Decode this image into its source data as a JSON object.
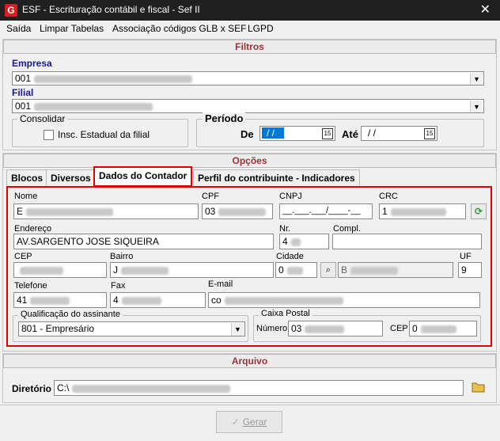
{
  "window": {
    "title": "ESF - Escrituração contábil e fiscal - Sef II",
    "logo_letter": "G",
    "close_glyph": "✕"
  },
  "menu": [
    "Saída",
    "Limpar Tabelas",
    "Associação códigos GLB x SEF",
    "LGPD"
  ],
  "filtros": {
    "header": "Filtros",
    "empresa_label": "Empresa",
    "empresa_value": "001",
    "filial_label": "Filial",
    "filial_value": "001",
    "consolidar_title": "Consolidar",
    "insc_label": "Insc. Estadual da filial",
    "periodo_title": "Período",
    "de_label": "De",
    "de_value": "/ /",
    "ate_label": "Até",
    "ate_value": "/ /",
    "cal_icon": "15"
  },
  "opcoes": {
    "header": "Opções",
    "tabs": [
      "Blocos",
      "Diversos",
      "Dados do Contador",
      "Perfil do contribuinte - Indicadores"
    ],
    "active_tab": 2
  },
  "contador": {
    "nome_label": "Nome",
    "nome_value": "E",
    "cpf_label": "CPF",
    "cpf_value": "03",
    "cnpj_label": "CNPJ",
    "cnpj_value": "__.___.___/____-__",
    "crc_label": "CRC",
    "crc_value": "1",
    "endereco_label": "Endereço",
    "endereco_value": "AV.SARGENTO JOSE SIQUEIRA",
    "nr_label": "Nr.",
    "nr_value": "4",
    "compl_label": "Compl.",
    "compl_value": "",
    "cep_label": "CEP",
    "cep_value": "",
    "bairro_label": "Bairro",
    "bairro_value": "J",
    "cidade_label": "Cidade",
    "cidade_value": "0",
    "cidade_name": "B",
    "uf_label": "UF",
    "uf_value": "9",
    "telefone_label": "Telefone",
    "telefone_value": "41",
    "fax_label": "Fax",
    "fax_value": "4",
    "email_label": "E-mail",
    "email_value": "co",
    "qualificacao_title": "Qualificação do assinante",
    "qualificacao_value": "801 - Empresário",
    "caixa_title": "Caixa Postal",
    "numero_label": "Número",
    "numero_value": "03",
    "cep2_label": "CEP",
    "cep2_value": "0"
  },
  "arquivo": {
    "header": "Arquivo",
    "diretorio_label": "Diretório",
    "diretorio_value": "C:\\"
  },
  "gerar_label": "Gerar",
  "icons": {
    "refresh": "refresh-icon",
    "binoculars": "binoculars-icon",
    "folder": "folder-icon",
    "check": "check-icon"
  }
}
